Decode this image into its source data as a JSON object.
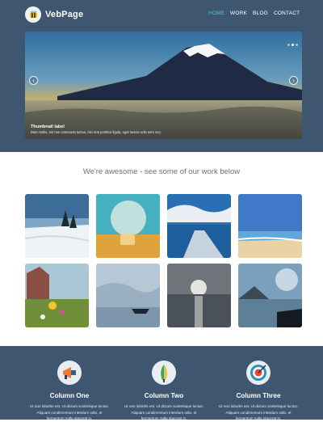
{
  "brand": {
    "name": "VebPage",
    "logo_icon": "bee-logo-icon"
  },
  "nav": {
    "items": [
      {
        "label": "HOME",
        "active": true
      },
      {
        "label": "WORK",
        "active": false
      },
      {
        "label": "BLOG",
        "active": false
      },
      {
        "label": "CONTACT",
        "active": false
      }
    ]
  },
  "carousel": {
    "slide_image": "mount-fuji-sunrise",
    "caption_title": "Thumbnail label",
    "caption_text": "Duis mollis, est non commodo luctus, nisi erat porttitor ligula, eget lacinia odio sem nec.",
    "prev_icon": "chevron-left-icon",
    "next_icon": "chevron-right-icon",
    "indicator_count": 3,
    "active_indicator": 1
  },
  "section": {
    "tagline": "We're awesome - see some of our work below"
  },
  "gallery": {
    "items": [
      {
        "image": "snowy-trees"
      },
      {
        "image": "hay-bale-sunset"
      },
      {
        "image": "wooden-pier"
      },
      {
        "image": "beach"
      },
      {
        "image": "wildflowers-cottage"
      },
      {
        "image": "fishing-boat-fog"
      },
      {
        "image": "lake-sunset"
      },
      {
        "image": "lake-silhouette"
      }
    ]
  },
  "features": [
    {
      "title": "Column One",
      "icon": "megaphone-icon",
      "text": "Ut non lobortis est. Ut dictum scelerisque luctus. Aliquam condimentum interdum odio, et fermentum nulla placerat in."
    },
    {
      "title": "Column Two",
      "icon": "pen-nib-icon",
      "text": "Ut non lobortis est. Ut dictum scelerisque luctus. Aliquam condimentum interdum odio, et fermentum nulla placerat in."
    },
    {
      "title": "Column Three",
      "icon": "target-icon",
      "text": "Ut non lobortis est. Ut dictum scelerisque luctus. Aliquam condimentum interdum odio, et fermentum nulla placerat in."
    }
  ],
  "colors": {
    "header_bg": "#3f5670",
    "accent": "#4bc3c7",
    "footer_bg": "#3f5670"
  }
}
